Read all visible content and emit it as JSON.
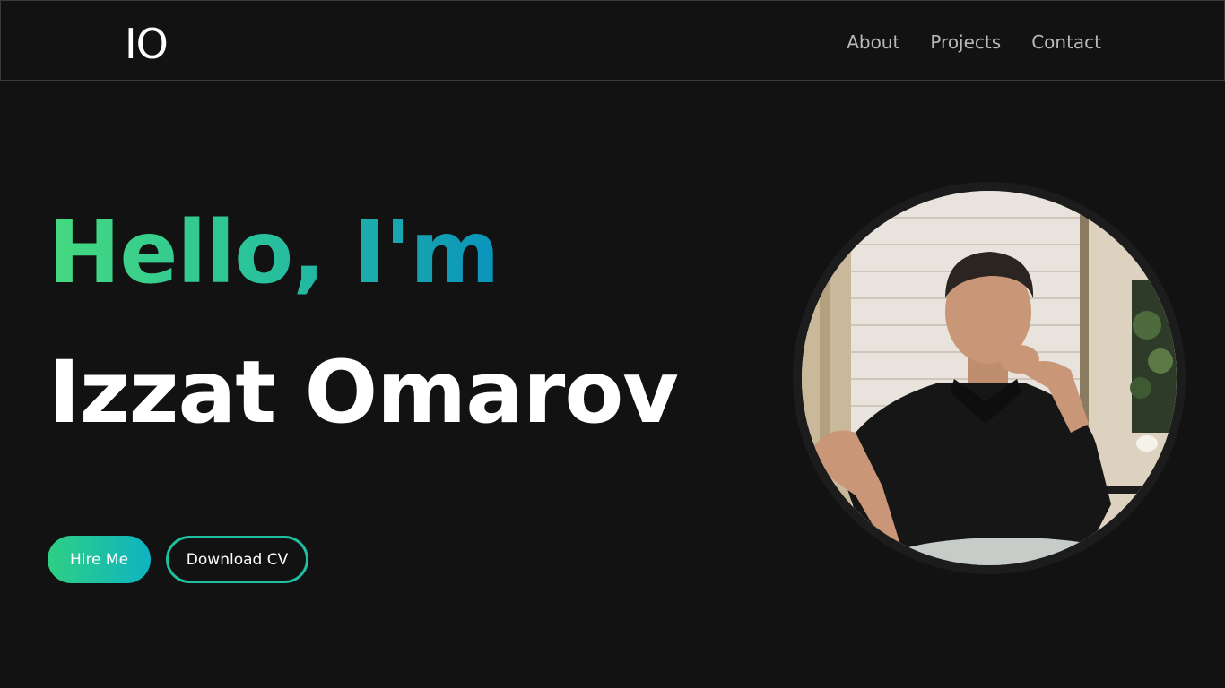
{
  "header": {
    "logo": "IO",
    "nav": [
      "About",
      "Projects",
      "Contact"
    ]
  },
  "hero": {
    "greeting": "Hello, I'm",
    "name": "Izzat Omarov",
    "hire_label": "Hire Me",
    "cv_label": "Download CV"
  },
  "colors": {
    "background": "#121212",
    "gradient_start": "#46d97f",
    "gradient_end": "#0a93bd",
    "outline_accent": "#1ec0a0"
  }
}
